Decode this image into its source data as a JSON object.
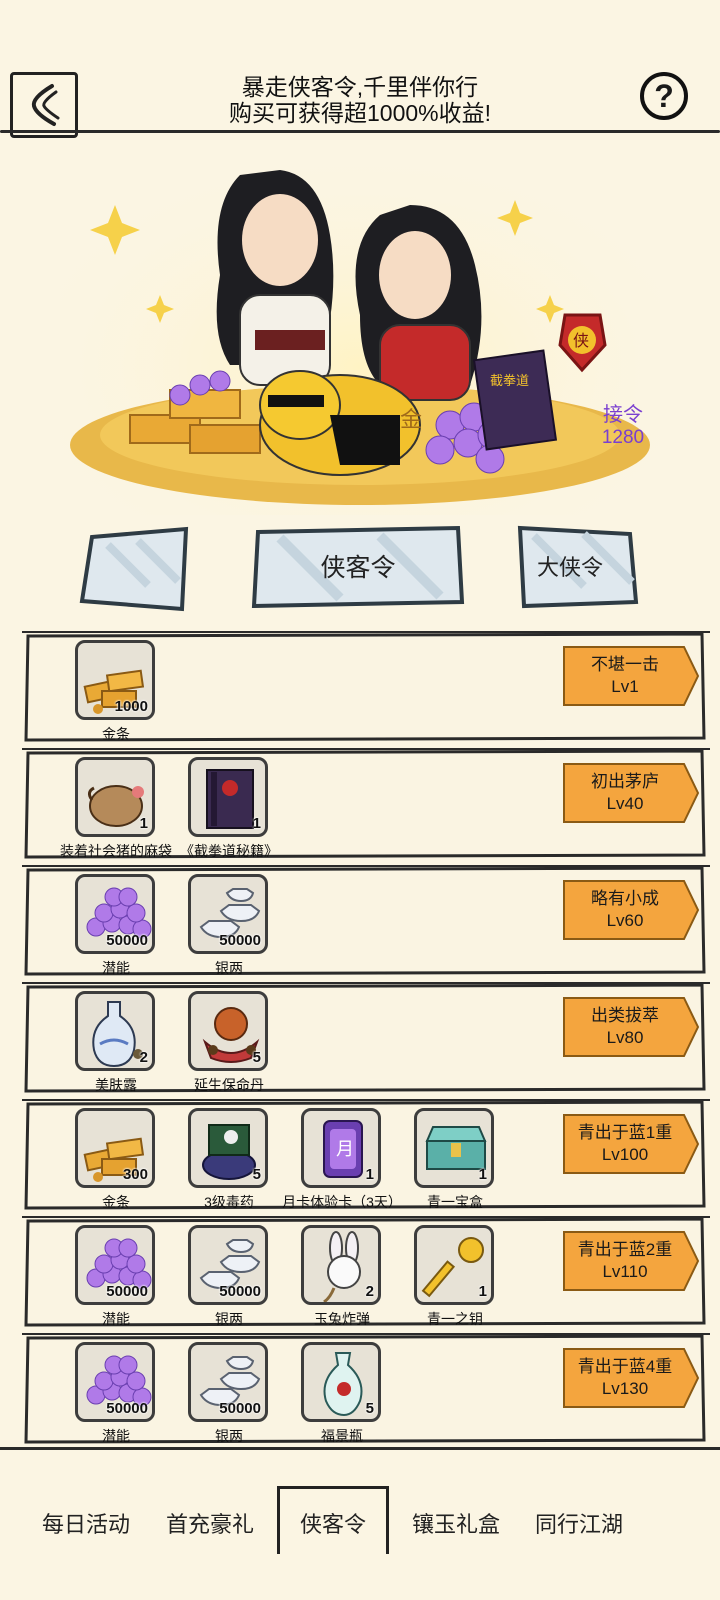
{
  "header": {
    "title_line1": "暴走侠客令,千里伴你行",
    "title_line2": "购买可获得超1000%收益!",
    "help_symbol": "?"
  },
  "hero": {
    "ticket_label": "接令",
    "ticket_count": "1280",
    "book_title": "截拳道",
    "badge_char": "侠",
    "gold_char": "金"
  },
  "tabs": [
    {
      "label": ""
    },
    {
      "label": "侠客令"
    },
    {
      "label": "大侠令"
    }
  ],
  "rows": [
    {
      "tag": "不堪一击",
      "level": "Lv1",
      "items": [
        {
          "name": "金条",
          "count": "1000",
          "icon": "gold-bars-icon"
        }
      ]
    },
    {
      "tag": "初出茅庐",
      "level": "Lv40",
      "items": [
        {
          "name": "装着社会猪的麻袋",
          "count": "1",
          "icon": "sack-icon"
        },
        {
          "name": "《截拳道秘籍》",
          "count": "1",
          "icon": "book-icon"
        }
      ]
    },
    {
      "tag": "略有小成",
      "level": "Lv60",
      "items": [
        {
          "name": "潜能",
          "count": "50000",
          "icon": "potential-orbs-icon"
        },
        {
          "name": "银两",
          "count": "50000",
          "icon": "silver-ingots-icon"
        }
      ]
    },
    {
      "tag": "出类拔萃",
      "level": "Lv80",
      "items": [
        {
          "name": "美肤露",
          "count": "2",
          "icon": "potion-bottle-icon"
        },
        {
          "name": "延生保命丹",
          "count": "5",
          "icon": "elixir-pills-icon"
        }
      ]
    },
    {
      "tag": "青出于蓝1重",
      "level": "Lv100",
      "items": [
        {
          "name": "金条",
          "count": "300",
          "icon": "gold-bars-icon"
        },
        {
          "name": "3级毒药",
          "count": "5",
          "icon": "poison-icon"
        },
        {
          "name": "月卡体验卡（3天）",
          "count": "1",
          "icon": "month-card-icon"
        },
        {
          "name": "青一宝盒",
          "count": "1",
          "icon": "treasure-box-icon"
        }
      ]
    },
    {
      "tag": "青出于蓝2重",
      "level": "Lv110",
      "items": [
        {
          "name": "潜能",
          "count": "50000",
          "icon": "potential-orbs-icon"
        },
        {
          "name": "银两",
          "count": "50000",
          "icon": "silver-ingots-icon"
        },
        {
          "name": "玉兔炸弹",
          "count": "2",
          "icon": "rabbit-bomb-icon"
        },
        {
          "name": "青一之钥",
          "count": "1",
          "icon": "key-icon"
        }
      ]
    },
    {
      "tag": "青出于蓝4重",
      "level": "Lv130",
      "items": [
        {
          "name": "潜能",
          "count": "50000",
          "icon": "potential-orbs-icon"
        },
        {
          "name": "银两",
          "count": "50000",
          "icon": "silver-ingots-icon"
        },
        {
          "name": "福景瓶",
          "count": "5",
          "icon": "vase-icon"
        }
      ]
    }
  ],
  "bottom_nav": [
    {
      "label": "每日活动"
    },
    {
      "label": "首充豪礼"
    },
    {
      "label": "侠客令",
      "active": true
    },
    {
      "label": "镶玉礼盒"
    },
    {
      "label": "同行江湖"
    }
  ],
  "colors": {
    "background": "#fbf5e3",
    "level_tag": "#f4a53e",
    "ticket_text": "#7a3fd0",
    "item_box": "#e7e2d6"
  }
}
